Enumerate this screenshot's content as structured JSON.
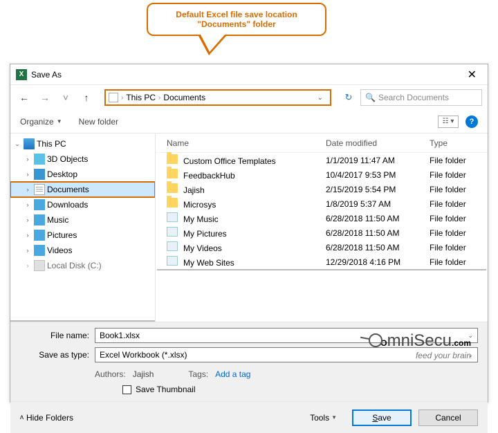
{
  "callout": {
    "line1": "Default Excel file save location",
    "line2": "\"Documents\" folder"
  },
  "window": {
    "title": "Save As"
  },
  "breadcrumb": {
    "items": [
      "This PC",
      "Documents"
    ]
  },
  "search": {
    "placeholder": "Search Documents"
  },
  "toolbar": {
    "organize": "Organize",
    "new_folder": "New folder"
  },
  "tree": {
    "this_pc": "This PC",
    "objects_3d": "3D Objects",
    "desktop": "Desktop",
    "documents": "Documents",
    "downloads": "Downloads",
    "music": "Music",
    "pictures": "Pictures",
    "videos": "Videos",
    "local_disk": "Local Disk (C:)"
  },
  "columns": {
    "name": "Name",
    "date": "Date modified",
    "type": "Type"
  },
  "files": [
    {
      "name": "Custom Office Templates",
      "date": "1/1/2019 11:47 AM",
      "type": "File folder",
      "icon": "folder"
    },
    {
      "name": "FeedbackHub",
      "date": "10/4/2017 9:53 PM",
      "type": "File folder",
      "icon": "folder"
    },
    {
      "name": "Jajish",
      "date": "2/15/2019 5:54 PM",
      "type": "File folder",
      "icon": "folder"
    },
    {
      "name": "Microsys",
      "date": "1/8/2019 5:37 AM",
      "type": "File folder",
      "icon": "folder"
    },
    {
      "name": "My Music",
      "date": "6/28/2018 11:50 AM",
      "type": "File folder",
      "icon": "media"
    },
    {
      "name": "My Pictures",
      "date": "6/28/2018 11:50 AM",
      "type": "File folder",
      "icon": "media"
    },
    {
      "name": "My Videos",
      "date": "6/28/2018 11:50 AM",
      "type": "File folder",
      "icon": "media"
    },
    {
      "name": "My Web Sites",
      "date": "12/29/2018 4:16 PM",
      "type": "File folder",
      "icon": "web"
    }
  ],
  "fields": {
    "file_name_label": "File name:",
    "file_name_value": "Book1.xlsx",
    "save_type_label": "Save as type:",
    "save_type_value": "Excel Workbook (*.xlsx)"
  },
  "meta": {
    "authors_label": "Authors:",
    "authors_value": "Jajish",
    "tags_label": "Tags:",
    "tags_value": "Add a tag",
    "save_thumb": "Save Thumbnail"
  },
  "footer": {
    "hide_folders": "Hide Folders",
    "tools": "Tools",
    "save": "Save",
    "cancel": "Cancel"
  },
  "logo": {
    "sub": "feed your brain"
  }
}
